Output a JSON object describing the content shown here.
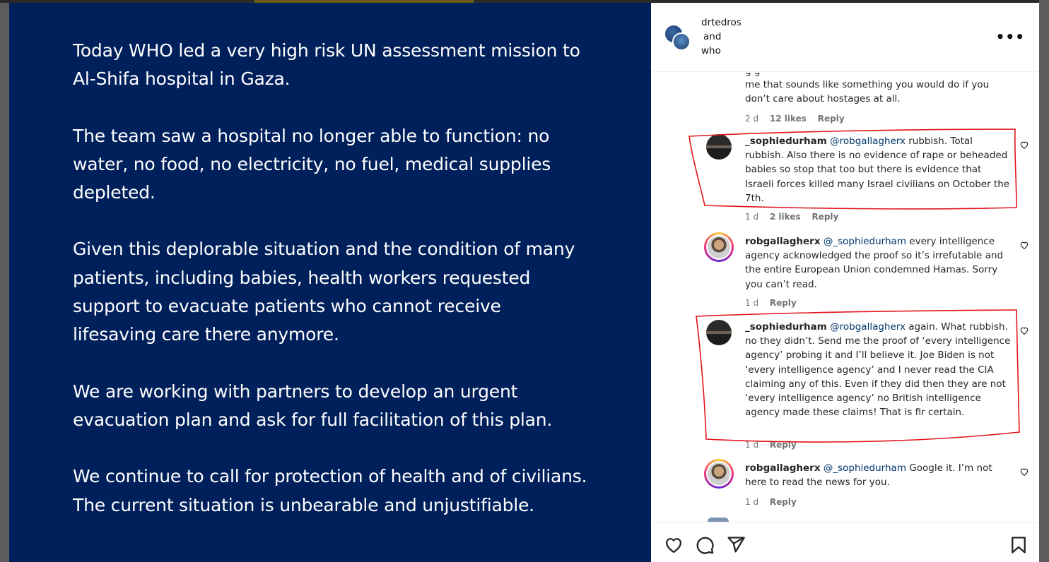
{
  "post_text": {
    "p1": "Today WHO led a very high risk UN assessment mission to Al-Shifa hospital in Gaza.",
    "p2": "The team saw a hospital no longer able to function: no water, no food, no electricity, no fuel, medical supplies depleted.",
    "p3": "Given this deplorable situation and the condition of many patients, including babies, health workers requested support to evacuate patients who cannot receive lifesaving care there anymore.",
    "p4": "We are working with partners to develop an urgent evacuation plan and ask for full facilitation of this plan.",
    "p5": "We continue to call for protection of health and of civilians. The current situation is unbearable and unjustifiable."
  },
  "header": {
    "author1": "drtedros",
    "conjunction": "and",
    "author2": "who",
    "more_icon": "more-horizontal-icon"
  },
  "comments": {
    "partial": {
      "text": "me that sounds like something you would do if you don’t care about hostages at all.",
      "time": "2 d",
      "likes": "12 likes",
      "reply": "Reply"
    },
    "c1": {
      "user": "_sophiedurham",
      "mention": "@robgallagherx",
      "text": " rubbish. Total rubbish. Also there is no evidence of rape or beheaded babies so stop that too but there is evidence that Israeli forces killed many Israel civilians on October the 7th.",
      "time": "1 d",
      "likes": "2 likes",
      "reply": "Reply"
    },
    "c2": {
      "user": "robgallagherx",
      "mention": "@_sophiedurham",
      "text": " every intelligence agency acknowledged the proof so it’s irrefutable and the entire European Union condemned Hamas. Sorry you can’t read.",
      "time": "1 d",
      "reply": "Reply"
    },
    "c3": {
      "user": "_sophiedurham",
      "mention": "@robgallagherx",
      "text": " again. What rubbish. no they didn’t. Send me the proof of ‘every intelligence agency’ probing it and I’ll believe it. Joe Biden is not ‘every intelligence agency’ and I never read the CIA claiming any of this. Even if they did then they are not ‘every intelligence agency’ no British intelligence agency made these claims! That is fir certain.",
      "time": "1 d",
      "reply": "Reply"
    },
    "c4": {
      "user": "robgallagherx",
      "mention": "@_sophiedurham",
      "text": " Google it. I’m not here to read the news for you.",
      "time": "1 d",
      "reply": "Reply"
    }
  },
  "actions": {
    "like_icon": "heart-icon",
    "comment_icon": "comment-icon",
    "share_icon": "send-icon",
    "save_icon": "bookmark-icon"
  },
  "colors": {
    "post_background": "#00205b",
    "annotation": "#e0151b",
    "mention": "#00376b"
  }
}
